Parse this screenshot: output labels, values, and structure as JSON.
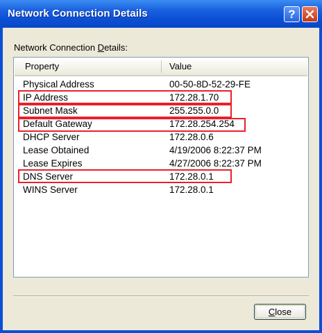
{
  "window": {
    "title": "Network Connection Details",
    "help_label": "?"
  },
  "group": {
    "label_before": "Network Connection ",
    "label_accel": "D",
    "label_after": "etails:"
  },
  "table": {
    "columns": [
      "Property",
      "Value"
    ],
    "rows": [
      {
        "property": "Physical Address",
        "value": "00-50-8D-52-29-FE",
        "highlighted": false
      },
      {
        "property": "IP Address",
        "value": "172.28.1.70",
        "highlighted": true
      },
      {
        "property": "Subnet Mask",
        "value": "255.255.0.0",
        "highlighted": true
      },
      {
        "property": "Default Gateway",
        "value": "172.28.254.254",
        "highlighted": true
      },
      {
        "property": "DHCP Server",
        "value": "172.28.0.6",
        "highlighted": false
      },
      {
        "property": "Lease Obtained",
        "value": "4/19/2006 8:22:37 PM",
        "highlighted": false
      },
      {
        "property": "Lease Expires",
        "value": "4/27/2006 8:22:37 PM",
        "highlighted": false
      },
      {
        "property": "DNS Server",
        "value": "172.28.0.1",
        "highlighted": true
      },
      {
        "property": "WINS Server",
        "value": "172.28.0.1",
        "highlighted": false
      }
    ]
  },
  "buttons": {
    "close_accel": "C",
    "close_rest": "lose"
  },
  "colors": {
    "titlebar": "#0a4fd6",
    "highlight_box": "#e8202a",
    "dialog_bg": "#ece9d8"
  }
}
